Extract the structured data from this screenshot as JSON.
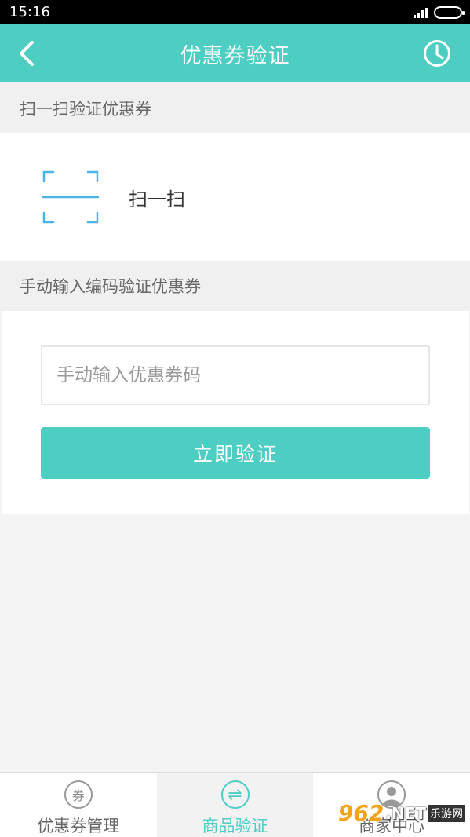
{
  "status_bar": {
    "time": "15:16"
  },
  "nav": {
    "title": "优惠券验证"
  },
  "scan_section": {
    "header": "扫一扫验证优惠券",
    "scan_label": "扫一扫"
  },
  "manual_section": {
    "header": "手动输入编码验证优惠券",
    "input_placeholder": "手动输入优惠券码",
    "input_value": "",
    "verify_label": "立即验证"
  },
  "tabs": [
    {
      "label": "优惠券管理",
      "icon": "coupon-icon",
      "icon_glyph": "券",
      "active": false
    },
    {
      "label": "商品验证",
      "icon": "exchange-icon",
      "icon_glyph": "⇌",
      "active": true
    },
    {
      "label": "商家中心",
      "icon": "user-icon",
      "icon_glyph": "",
      "active": false
    }
  ],
  "watermark": {
    "number": "962",
    "suffix": ".NET",
    "site": "乐游网"
  },
  "colors": {
    "accent": "#4ecdc3",
    "scan_icon": "#4ab6e8"
  }
}
